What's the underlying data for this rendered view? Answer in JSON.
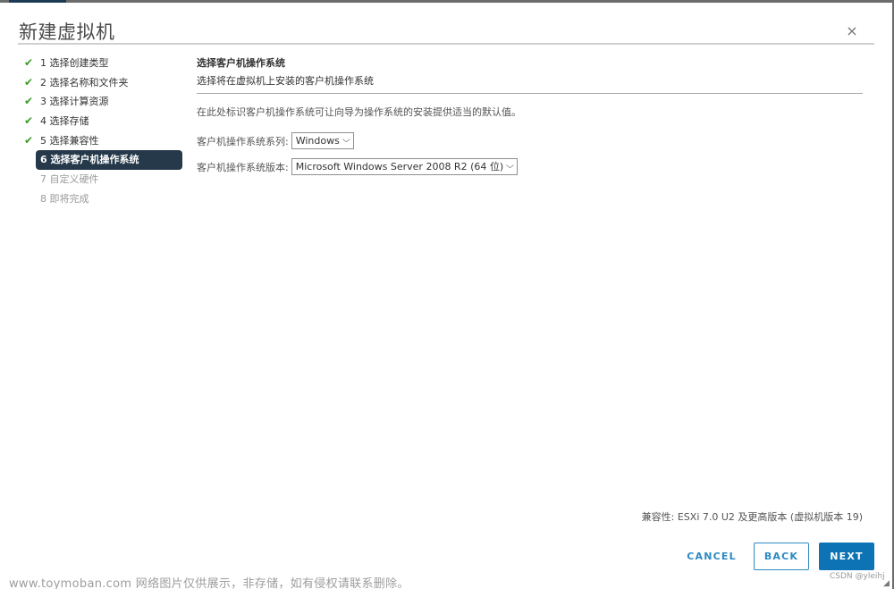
{
  "dialog": {
    "title": "新建虚拟机",
    "close_icon": "close-icon"
  },
  "steps": [
    {
      "label": "1 选择创建类型",
      "state": "done"
    },
    {
      "label": "2 选择名称和文件夹",
      "state": "done"
    },
    {
      "label": "3 选择计算资源",
      "state": "done"
    },
    {
      "label": "4 选择存储",
      "state": "done"
    },
    {
      "label": "5 选择兼容性",
      "state": "done"
    },
    {
      "label": "6 选择客户机操作系统",
      "state": "active"
    },
    {
      "label": "7 自定义硬件",
      "state": "pending"
    },
    {
      "label": "8 即将完成",
      "state": "pending"
    }
  ],
  "content": {
    "title": "选择客户机操作系统",
    "subtitle": "选择将在虚拟机上安装的客户机操作系统",
    "description": "在此处标识客户机操作系统可让向导为操作系统的安装提供适当的默认值。",
    "os_family": {
      "label": "客户机操作系统系列:",
      "value": "Windows"
    },
    "os_version": {
      "label": "客户机操作系统版本:",
      "value": "Microsoft Windows Server 2008 R2 (64 位)"
    }
  },
  "footer": {
    "compatibility": "兼容性: ESXi 7.0 U2 及更高版本 (虚拟机版本 19)",
    "cancel_label": "CANCEL",
    "back_label": "BACK",
    "next_label": "NEXT"
  },
  "overlay": {
    "csdn": "CSDN @yleihj",
    "watermark": "www.toymoban.com 网络图片仅供展示，非存储，如有侵权请联系删除。"
  },
  "icons": {
    "check": "✔",
    "close": "×",
    "chevron": "⌄",
    "resize": "◢"
  },
  "colors": {
    "accent": "#0d73b4",
    "active_step": "#25394a",
    "check": "#3c9a2a"
  }
}
